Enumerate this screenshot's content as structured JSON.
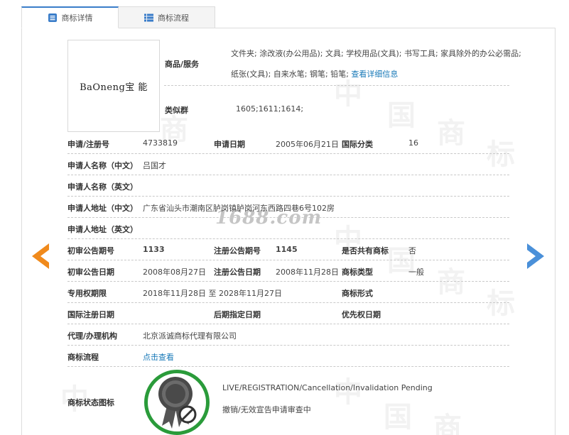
{
  "tabs": [
    {
      "label": "商标详情",
      "icon": "document-icon",
      "active": true
    },
    {
      "label": "商标流程",
      "icon": "list-icon",
      "active": false
    }
  ],
  "logo": {
    "text": "BaOneng宝 能"
  },
  "watermark": {
    "site": "1688.com",
    "chars": [
      "中",
      "国",
      "商",
      "标"
    ]
  },
  "goods": {
    "label": "商品/服务",
    "line1": "文件夹; 涂改液(办公用品); 文具; 学校用品(文具); 书写工具; 家具除外的办公必需品;",
    "line2": "纸张(文具); 自来水笔; 钢笔; 铅笔;",
    "link": "查看详细信息"
  },
  "similar": {
    "label": "类似群",
    "value": "1605;1611;1614;"
  },
  "rows": {
    "reg_no": {
      "label": "申请/注册号",
      "value": "4733819"
    },
    "apply_date": {
      "label": "申请日期",
      "value": "2005年06月21日"
    },
    "intl_class": {
      "label": "国际分类",
      "value": "16"
    },
    "applicant_cn": {
      "label": "申请人名称（中文）",
      "value": "吕国才"
    },
    "applicant_en": {
      "label": "申请人名称（英文）",
      "value": ""
    },
    "address_cn": {
      "label": "申请人地址（中文）",
      "value": "广东省汕头市潮南区胪岗镇胪岗河东西路四巷6号102房"
    },
    "address_en": {
      "label": "申请人地址（英文）",
      "value": ""
    },
    "prelim_no": {
      "label": "初审公告期号",
      "value": "1133"
    },
    "reg_pub_no": {
      "label": "注册公告期号",
      "value": "1145"
    },
    "shared": {
      "label": "是否共有商标",
      "value": "否"
    },
    "prelim_date": {
      "label": "初审公告日期",
      "value": "2008年08月27日"
    },
    "reg_pub_date": {
      "label": "注册公告日期",
      "value": "2008年11月28日"
    },
    "mark_type": {
      "label": "商标类型",
      "value": "一般"
    },
    "exclusive": {
      "label": "专用权期限",
      "value": "2018年11月28日 至 2028年11月27日"
    },
    "mark_form": {
      "label": "商标形式",
      "value": ""
    },
    "intl_reg_date": {
      "label": "国际注册日期",
      "value": ""
    },
    "later_date": {
      "label": "后期指定日期",
      "value": ""
    },
    "priority_date": {
      "label": "优先权日期",
      "value": ""
    },
    "agent": {
      "label": "代理/办理机构",
      "value": "北京派诚商标代理有限公司"
    },
    "process": {
      "label": "商标流程",
      "link": "点击查看"
    }
  },
  "status": {
    "label": "商标状态图标",
    "en": "LIVE/REGISTRATION/Cancellation/Invalidation Pending",
    "cn": "撤销/无效宣告申请审查中",
    "ring_color": "#2a9b3a"
  },
  "nav": {
    "prev_color": "#f08a1c",
    "next_color": "#4a90d9"
  }
}
